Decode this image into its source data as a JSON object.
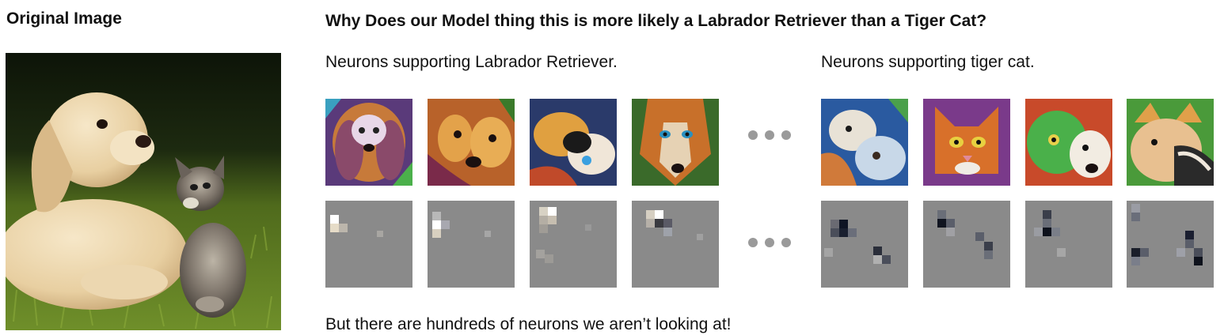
{
  "left_panel": {
    "title": "Original Image"
  },
  "right_panel": {
    "title": "Why Does our Model thing this is more likely a Labrador Retriever than a Tiger Cat?",
    "labrador_group": {
      "label": "Neurons supporting Labrador Retriever."
    },
    "tiger_cat_group": {
      "label": "Neurons supporting tiger cat."
    },
    "footer": "But there are hundreds of neurons we aren’t looking at!"
  },
  "colors": {
    "text": "#111111",
    "attribution_gray": "#8a8a8a",
    "ellipsis_dot": "#9a9a9a",
    "grass": "#6f8f2a",
    "sky_dark": "#0d1408"
  },
  "icons": {
    "ellipsis": "ellipsis-icon"
  }
}
